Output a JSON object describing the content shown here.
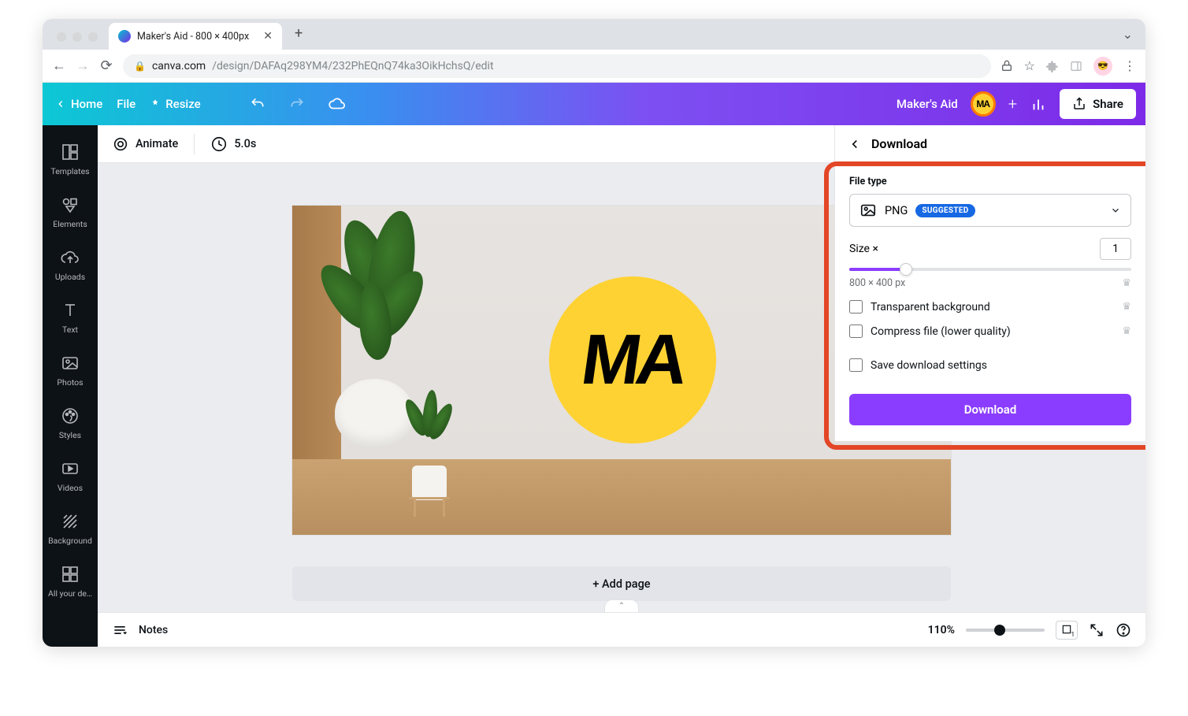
{
  "browser": {
    "tab_title": "Maker's Aid - 800 × 400px",
    "url_host": "canva.com",
    "url_path": "/design/DAFAq298YM4/232PhEQnQ74ka3OikHchsQ/edit"
  },
  "topbar": {
    "home": "Home",
    "file": "File",
    "resize": "Resize",
    "doc_title": "Maker's Aid",
    "user_badge": "MA",
    "share": "Share"
  },
  "sidebar": {
    "items": [
      {
        "label": "Templates"
      },
      {
        "label": "Elements"
      },
      {
        "label": "Uploads"
      },
      {
        "label": "Text"
      },
      {
        "label": "Photos"
      },
      {
        "label": "Styles"
      },
      {
        "label": "Videos"
      },
      {
        "label": "Background"
      },
      {
        "label": "All your de…"
      }
    ]
  },
  "context": {
    "animate": "Animate",
    "duration": "5.0s"
  },
  "canvas": {
    "logo_text": "MA",
    "add_page": "+ Add page"
  },
  "download_panel": {
    "title": "Download",
    "file_type_label": "File type",
    "file_type_value": "PNG",
    "suggested": "SUGGESTED",
    "size_label": "Size ×",
    "size_value": "1",
    "dimensions": "800 × 400 px",
    "transparent": "Transparent background",
    "compress": "Compress file (lower quality)",
    "save_settings": "Save download settings",
    "download_btn": "Download"
  },
  "footer": {
    "notes": "Notes",
    "zoom": "110%",
    "page": "1"
  }
}
